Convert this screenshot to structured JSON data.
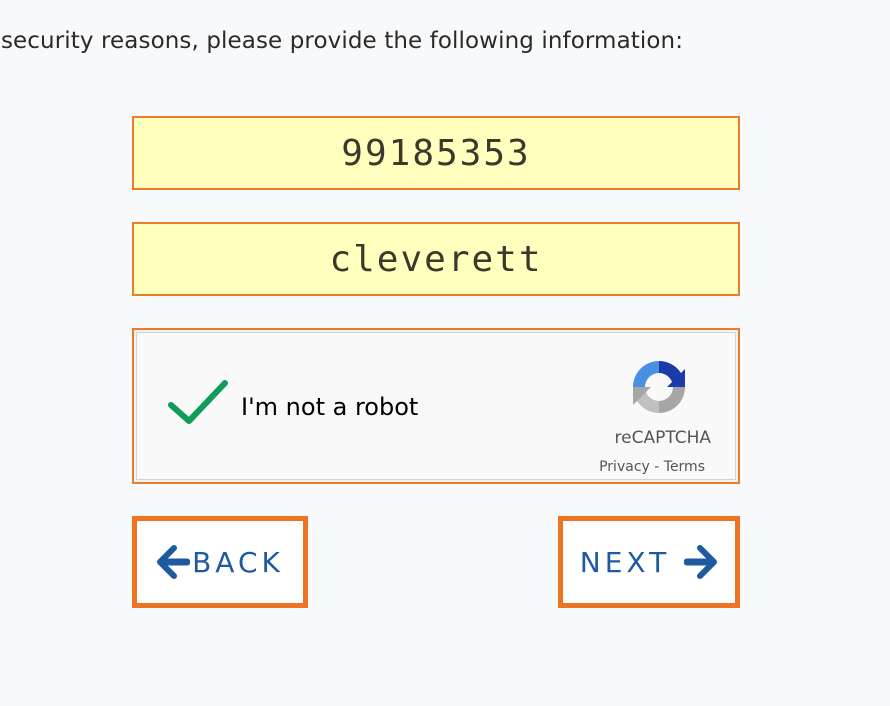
{
  "instructions": "r security reasons, please provide the following information:",
  "fields": {
    "id_value": "99185353",
    "username_value": "cleverett"
  },
  "captcha": {
    "label": "I'm not a robot",
    "brand": "reCAPTCHA",
    "privacy": "Privacy",
    "separator": " - ",
    "terms": "Terms",
    "checked": true,
    "check_icon": "checkmark-icon",
    "logo_icon": "recaptcha-logo-icon"
  },
  "nav": {
    "back_label": "BACK",
    "next_label": "NEXT",
    "back_icon": "arrow-left-icon",
    "next_icon": "arrow-right-icon"
  },
  "colors": {
    "border_accent": "#ea7a2c",
    "field_background": "#ffffbe",
    "button_text": "#1f5aa0",
    "check_green": "#0f9d58",
    "page_background": "#f8f9fb"
  }
}
